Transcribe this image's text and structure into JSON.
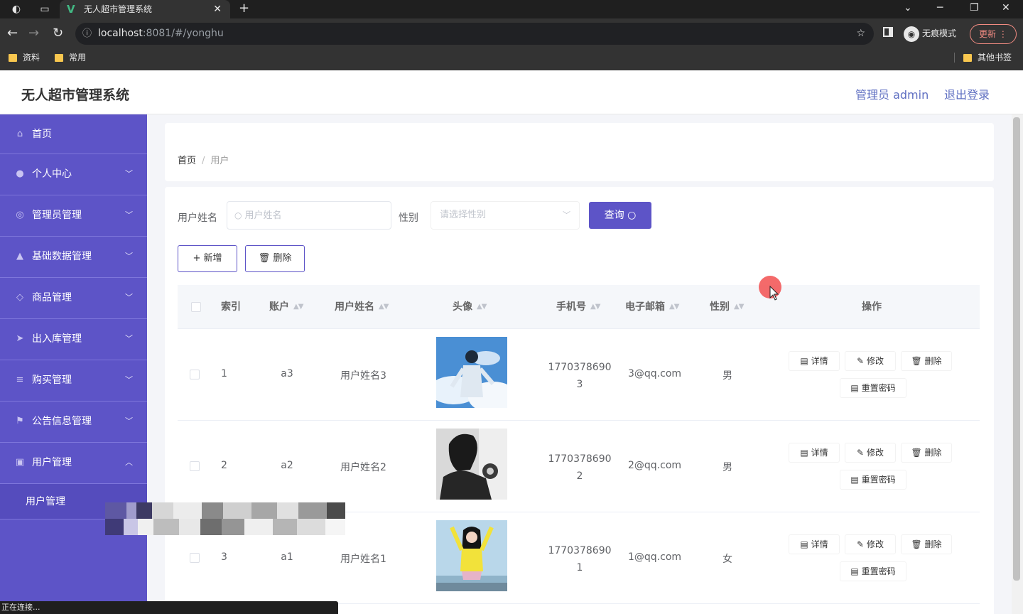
{
  "browser": {
    "tab_title": "无人超市管理系统",
    "url_host": "localhost",
    "url_path": ":8081/#/yonghu",
    "incognito_label": "无痕模式",
    "update_label": "更新",
    "bookmarks": [
      "资料",
      "常用"
    ],
    "other_bookmarks": "其他书签",
    "status_text": "正在连接..."
  },
  "header": {
    "title": "无人超市管理系统",
    "admin_label": "管理员 admin",
    "logout_label": "退出登录"
  },
  "sidebar": {
    "items": [
      {
        "label": "首页",
        "icon": "home-icon"
      },
      {
        "label": "个人中心",
        "icon": "user-icon"
      },
      {
        "label": "管理员管理",
        "icon": "admin-icon"
      },
      {
        "label": "基础数据管理",
        "icon": "data-icon"
      },
      {
        "label": "商品管理",
        "icon": "goods-icon"
      },
      {
        "label": "出入库管理",
        "icon": "send-icon"
      },
      {
        "label": "购买管理",
        "icon": "list-icon"
      },
      {
        "label": "公告信息管理",
        "icon": "flag-icon"
      },
      {
        "label": "用户管理",
        "icon": "user-manage-icon"
      }
    ],
    "submenu_label": "用户管理"
  },
  "breadcrumb": {
    "home": "首页",
    "current": "用户"
  },
  "search": {
    "name_label": "用户姓名",
    "name_placeholder": "用户姓名",
    "gender_label": "性别",
    "gender_placeholder": "请选择性别",
    "query_label": "查询"
  },
  "actions": {
    "add_label": "新增",
    "delete_label": "删除"
  },
  "table": {
    "columns": [
      "索引",
      "账户",
      "用户姓名",
      "头像",
      "手机号",
      "电子邮箱",
      "性别",
      "操作"
    ],
    "rows": [
      {
        "index": "1",
        "account": "a3",
        "name": "用户姓名3",
        "phone_1": "1770378690",
        "phone_2": "3",
        "email": "3@qq.com",
        "gender": "男"
      },
      {
        "index": "2",
        "account": "a2",
        "name": "用户姓名2",
        "phone_1": "1770378690",
        "phone_2": "2",
        "email": "2@qq.com",
        "gender": "男"
      },
      {
        "index": "3",
        "account": "a1",
        "name": "用户姓名1",
        "phone_1": "1770378690",
        "phone_2": "1",
        "email": "1@qq.com",
        "gender": "女"
      }
    ],
    "op_labels": {
      "detail": "详情",
      "edit": "修改",
      "delete": "删除",
      "reset": "重置密码"
    }
  },
  "colors": {
    "primary": "#5d54c7",
    "sidebar": "#5d54c7",
    "header_link": "#5f6fc2"
  }
}
